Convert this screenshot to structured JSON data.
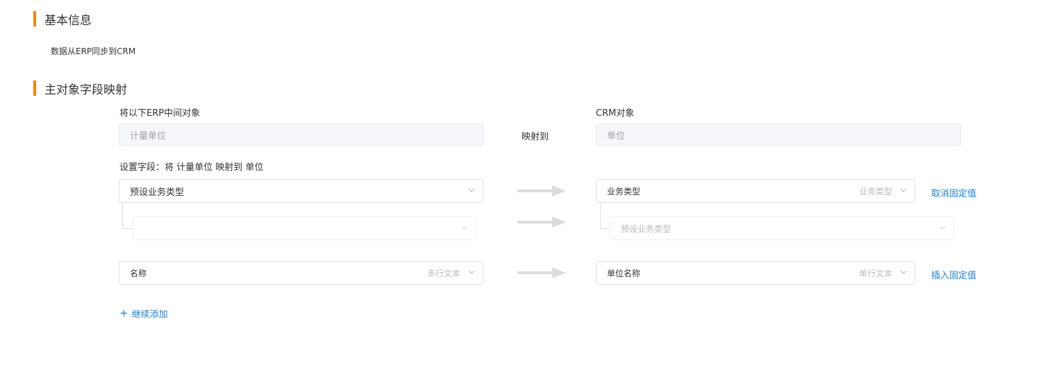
{
  "basic_info": {
    "title": "基本信息",
    "description": "数据从ERP同步到CRM"
  },
  "mapping": {
    "title": "主对象字段映射",
    "source_label": "将以下ERP中间对象",
    "target_label": "CRM对象",
    "source_object": "计量单位",
    "maps_to": "映射到",
    "target_object": "单位",
    "set_fields_label": "设置字段：将 计量单位 映射到 单位",
    "rows": [
      {
        "source_field": "预设业务类型",
        "source_type": "",
        "target_field": "业务类型",
        "target_type": "业务类型",
        "action": "取消固定值"
      },
      {
        "source_field": "名称",
        "source_type": "多行文本",
        "target_field": "单位名称",
        "target_type": "单行文本",
        "action": "插入固定值"
      }
    ],
    "sub_row": {
      "source_field": "",
      "target_field": "预设业务类型"
    },
    "add_more": "继续添加"
  }
}
